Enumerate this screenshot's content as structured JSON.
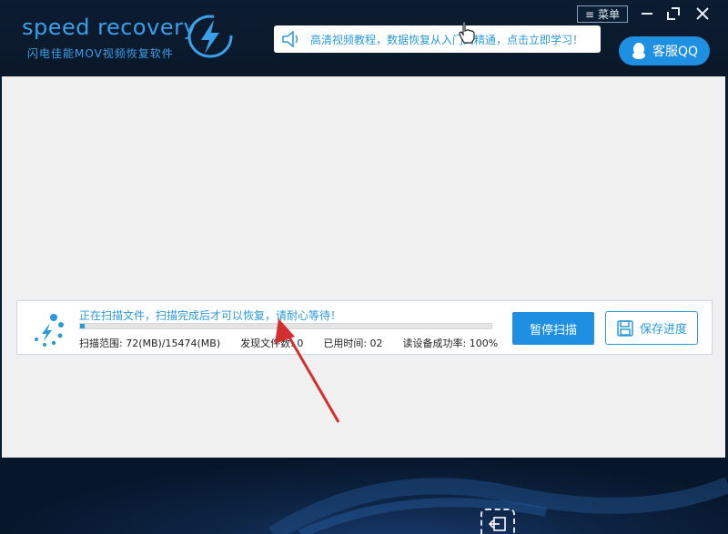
{
  "app": {
    "title": "speed recovery",
    "subtitle": "闪电佳能MOV视频恢复软件"
  },
  "notice": {
    "text": "高清视频教程，数据恢复从入门到精通，点击立即学习！"
  },
  "header_controls": {
    "menu_label": "菜单",
    "minimize": "—",
    "maximize": "□",
    "close": "✕"
  },
  "support": {
    "qq_label": "客服QQ"
  },
  "scan": {
    "status_text": "正在扫描文件，扫描完成后才可以恢复，请耐心等待！",
    "progress": 0.01,
    "range": "扫描范围: 72(MB)/15474(MB)",
    "found_files": "发现文件数: 0",
    "elapsed": "已用时间: 02",
    "read_rate": "读设备成功率: 100%",
    "pause_label": "暂停扫描",
    "save_label": "保存进度"
  },
  "colors": {
    "accent": "#1e8fe1",
    "header_bg": "#0c1c31",
    "panel_bg": "#f0f0f0",
    "arrow": "#d32f2f"
  }
}
